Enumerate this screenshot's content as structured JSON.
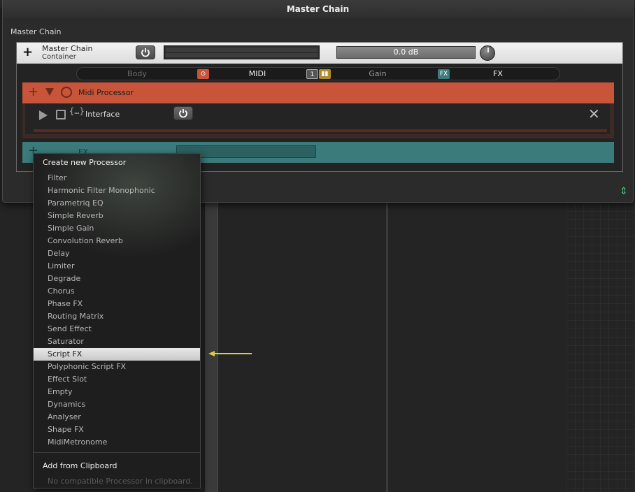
{
  "window": {
    "title": "Master Chain",
    "section_label": "Master Chain"
  },
  "container": {
    "name": "Master Chain",
    "type": "Container",
    "gain_value": "0.0 dB"
  },
  "tabs": [
    {
      "label": "Body"
    },
    {
      "label": "MIDI",
      "icon": "⊙"
    },
    {
      "label": "Gain",
      "icon": "1"
    },
    {
      "label": "FX",
      "icon": "FX"
    }
  ],
  "midi_processor": {
    "title": "Midi Processor",
    "interface_label": "Interface"
  },
  "fx_chain": {
    "label": "FX"
  },
  "menu": {
    "header": "Create new Processor",
    "items": [
      "Filter",
      "Harmonic Filter Monophonic",
      "Parametriq EQ",
      "Simple Reverb",
      "Simple Gain",
      "Convolution Reverb",
      "Delay",
      "Limiter",
      "Degrade",
      "Chorus",
      "Phase FX",
      "Routing Matrix",
      "Send Effect",
      "Saturator",
      "Script FX",
      "Polyphonic Script FX",
      "Effect Slot",
      "Empty",
      "Dynamics",
      "Analyser",
      "Shape FX",
      "MidiMetronome"
    ],
    "highlighted": "Script FX",
    "clipboard_header": "Add from Clipboard",
    "clipboard_status": "No compatible Processor in clipboard."
  },
  "colors": {
    "midi_accent": "#c8553a",
    "fx_accent": "#3b7b7b",
    "arrow": "#d8cf3a",
    "expand_icon": "#4ec27c"
  }
}
